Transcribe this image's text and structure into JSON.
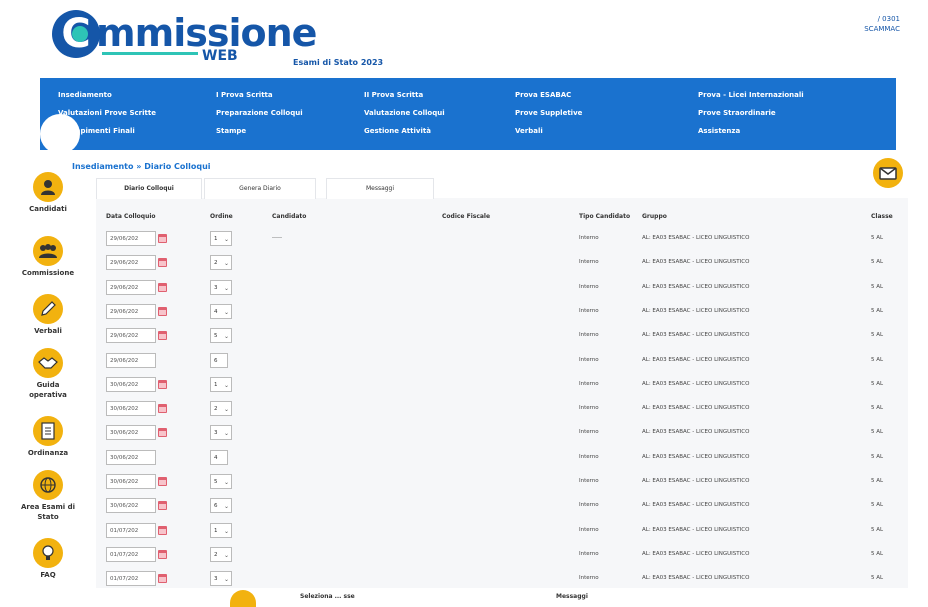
{
  "header": {
    "brand": "mmissione",
    "brand_web": "WEB",
    "exam_title": "Esami di Stato 2023",
    "user_line1": "/ 0301",
    "user_line2": "SCAMMAC"
  },
  "nav": {
    "columns": [
      [
        "Insediamento",
        "Valutazioni Prove Scritte",
        "Adempimenti Finali"
      ],
      [
        "I Prova Scritta",
        "Preparazione Colloqui",
        "Stampe"
      ],
      [
        "II Prova Scritta",
        "Valutazione Colloqui",
        "Gestione Attività"
      ],
      [
        "Prova ESABAC",
        "Prove Suppletive",
        "Verbali"
      ],
      [
        "Prova - Licei Internazionali",
        "Prove Straordinarie",
        "Assistenza"
      ]
    ]
  },
  "breadcrumb": "Insediamento » Diario Colloqui",
  "sidebar": {
    "items": [
      {
        "label": "Candidati",
        "icon": "user-icon"
      },
      {
        "label": "Commissione",
        "icon": "group-icon"
      },
      {
        "label": "Verbali",
        "icon": "pencil-icon"
      },
      {
        "label": "Guida operativa",
        "icon": "handshake-icon"
      },
      {
        "label": "Ordinanza",
        "icon": "document-icon"
      },
      {
        "label": "Area Esami di Stato",
        "icon": "globe-icon"
      },
      {
        "label": "FAQ",
        "icon": "lightbulb-icon"
      }
    ]
  },
  "tabs": [
    "Diario Colloqui",
    "Genera Diario",
    "Messaggi"
  ],
  "table": {
    "headers": [
      "Data Colloquio",
      "Ordine",
      "Candidato",
      "Codice Fiscale",
      "Tipo Candidato",
      "Gruppo",
      "Classe"
    ],
    "rows": [
      {
        "date": "29/06/202",
        "order": "1",
        "candidate": "-----",
        "type": "Interno",
        "group": "AL: EA03 ESABAC - LICEO LINGUISTICO",
        "class": "5 AL",
        "editable": true
      },
      {
        "date": "29/06/202",
        "order": "2",
        "candidate": "",
        "type": "Interno",
        "group": "AL: EA03 ESABAC - LICEO LINGUISTICO",
        "class": "5 AL",
        "editable": true
      },
      {
        "date": "29/06/202",
        "order": "3",
        "candidate": "",
        "type": "Interno",
        "group": "AL: EA03 ESABAC - LICEO LINGUISTICO",
        "class": "5 AL",
        "editable": true
      },
      {
        "date": "29/06/202",
        "order": "4",
        "candidate": "",
        "type": "Interno",
        "group": "AL: EA03 ESABAC - LICEO LINGUISTICO",
        "class": "5 AL",
        "editable": true
      },
      {
        "date": "29/06/202",
        "order": "5",
        "candidate": "",
        "type": "Interno",
        "group": "AL: EA03 ESABAC - LICEO LINGUISTICO",
        "class": "5 AL",
        "editable": true
      },
      {
        "date": "29/06/202",
        "order": "6",
        "candidate": "",
        "type": "Interno",
        "group": "AL: EA03 ESABAC - LICEO LINGUISTICO",
        "class": "5 AL",
        "editable": false
      },
      {
        "date": "30/06/202",
        "order": "1",
        "candidate": "",
        "type": "Interno",
        "group": "AL: EA03 ESABAC - LICEO LINGUISTICO",
        "class": "5 AL",
        "editable": true
      },
      {
        "date": "30/06/202",
        "order": "2",
        "candidate": "",
        "type": "Interno",
        "group": "AL: EA03 ESABAC - LICEO LINGUISTICO",
        "class": "5 AL",
        "editable": true
      },
      {
        "date": "30/06/202",
        "order": "3",
        "candidate": "",
        "type": "Interno",
        "group": "AL: EA03 ESABAC - LICEO LINGUISTICO",
        "class": "5 AL",
        "editable": true
      },
      {
        "date": "30/06/202",
        "order": "4",
        "candidate": "",
        "type": "Interno",
        "group": "AL: EA03 ESABAC - LICEO LINGUISTICO",
        "class": "5 AL",
        "editable": false
      },
      {
        "date": "30/06/202",
        "order": "5",
        "candidate": "",
        "type": "Interno",
        "group": "AL: EA03 ESABAC - LICEO LINGUISTICO",
        "class": "5 AL",
        "editable": true
      },
      {
        "date": "30/06/202",
        "order": "6",
        "candidate": "",
        "type": "Interno",
        "group": "AL: EA03 ESABAC - LICEO LINGUISTICO",
        "class": "5 AL",
        "editable": true
      },
      {
        "date": "01/07/202",
        "order": "1",
        "candidate": "",
        "type": "Interno",
        "group": "AL: EA03 ESABAC - LICEO LINGUISTICO",
        "class": "5 AL",
        "editable": true
      },
      {
        "date": "01/07/202",
        "order": "2",
        "candidate": "",
        "type": "Interno",
        "group": "AL: EA03 ESABAC - LICEO LINGUISTICO",
        "class": "5 AL",
        "editable": true
      },
      {
        "date": "01/07/202",
        "order": "3",
        "candidate": "",
        "type": "Interno",
        "group": "AL: EA03 ESABAC - LICEO LINGUISTICO",
        "class": "5 AL",
        "editable": true
      }
    ]
  },
  "bottom": {
    "select_label": "Seleziona ... sse",
    "messages_label": "Messaggi"
  },
  "colors": {
    "brand_blue": "#1556a8",
    "nav_blue": "#1a72cf",
    "accent_teal": "#2ec4b6",
    "icon_yellow": "#f2b20f"
  }
}
